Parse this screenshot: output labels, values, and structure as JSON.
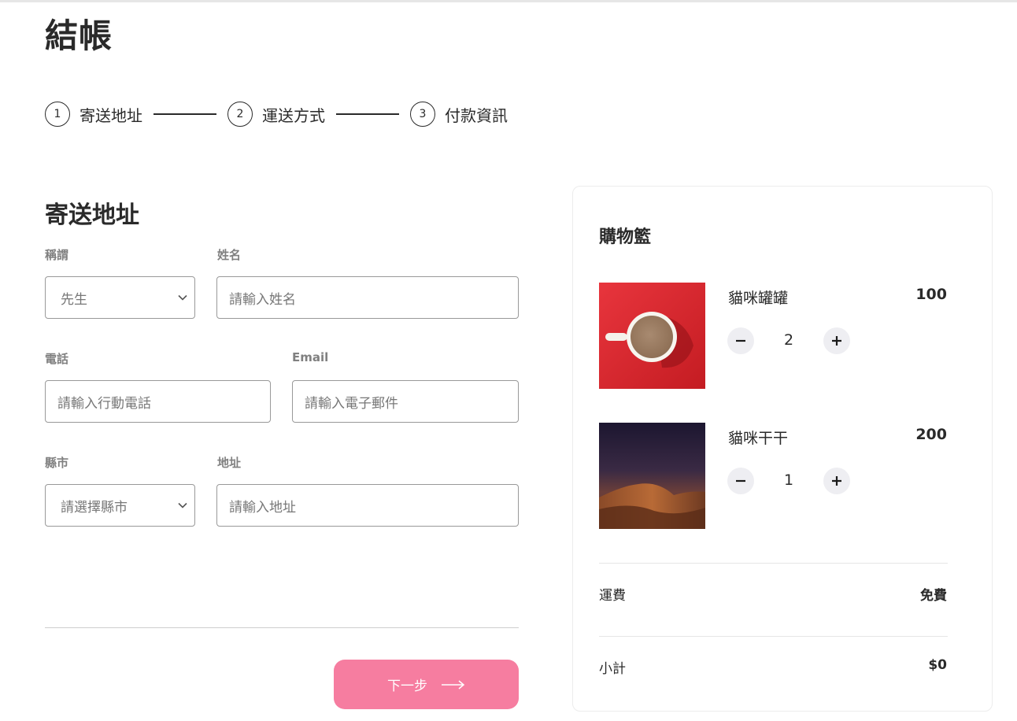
{
  "page": {
    "title": "結帳"
  },
  "stepper": {
    "steps": [
      {
        "number": "1",
        "label": "寄送地址"
      },
      {
        "number": "2",
        "label": "運送方式"
      },
      {
        "number": "3",
        "label": "付款資訊"
      }
    ]
  },
  "form": {
    "section_title": "寄送地址",
    "salutation": {
      "label": "稱謂",
      "value": "先生"
    },
    "name": {
      "label": "姓名",
      "placeholder": "請輸入姓名"
    },
    "phone": {
      "label": "電話",
      "placeholder": "請輸入行動電話"
    },
    "email": {
      "label": "Email",
      "placeholder": "請輸入電子郵件"
    },
    "city": {
      "label": "縣市",
      "value": "請選擇縣市"
    },
    "address": {
      "label": "地址",
      "placeholder": "請輸入地址"
    },
    "next_label": "下一步"
  },
  "cart": {
    "title": "購物籃",
    "items": [
      {
        "name": "貓咪罐罐",
        "price": "100",
        "quantity": "2",
        "thumb": "coffee-cup-image"
      },
      {
        "name": "貓咪干干",
        "price": "200",
        "quantity": "1",
        "thumb": "desert-night-image"
      }
    ],
    "shipping": {
      "label": "運費",
      "value": "免費"
    },
    "subtotal": {
      "label": "小計",
      "value": "$0"
    }
  },
  "colors": {
    "accent": "#f67da0",
    "text": "#2a2a2a",
    "muted_label": "#808080",
    "qty_button_bg": "#eeeef2"
  },
  "icons": {
    "select_chevron": "chevron-down-icon",
    "next_arrow": "arrow-right-icon",
    "minus": "minus-icon",
    "plus": "plus-icon"
  }
}
